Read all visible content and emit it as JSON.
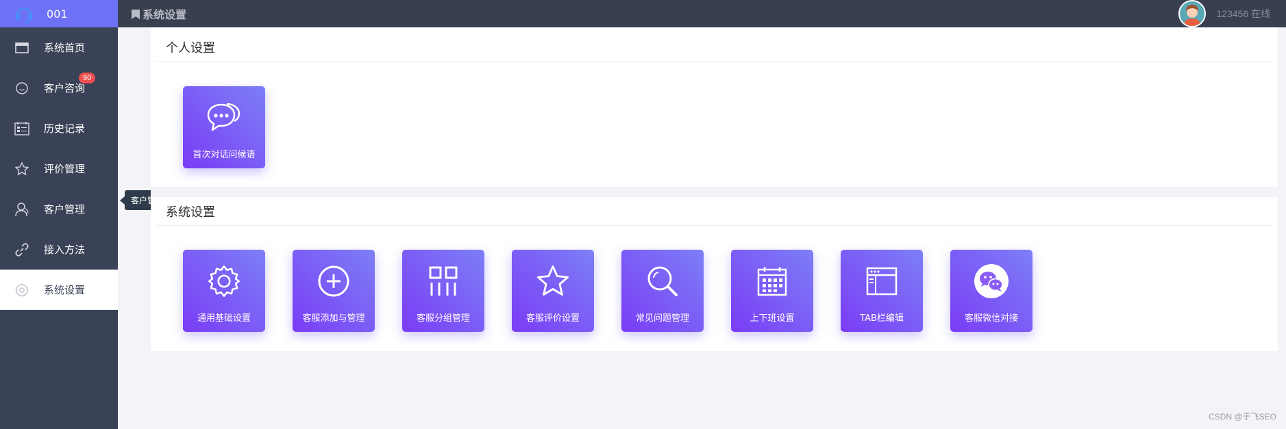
{
  "brand": {
    "id": "001",
    "logo_icon": "headset-icon"
  },
  "header": {
    "title": "系统设置",
    "username": "123456",
    "status": "在线"
  },
  "sidebar": {
    "items": [
      {
        "label": "系统首页",
        "icon": "window-icon"
      },
      {
        "label": "客户咨询",
        "icon": "chat-bubble-icon",
        "badge": "90"
      },
      {
        "label": "历史记录",
        "icon": "calendar-list-icon"
      },
      {
        "label": "评价管理",
        "icon": "star-icon"
      },
      {
        "label": "客户管理",
        "icon": "user-icon"
      },
      {
        "label": "接入方法",
        "icon": "link-icon"
      },
      {
        "label": "系统设置",
        "icon": "gear-icon",
        "active": true
      }
    ]
  },
  "tooltip": {
    "text": "客户管理"
  },
  "personal": {
    "heading": "个人设置",
    "tiles": [
      {
        "label": "首次对话问候语",
        "icon": "chat-dots-icon"
      }
    ]
  },
  "system": {
    "heading": "系统设置",
    "tiles": [
      {
        "label": "通用基础设置",
        "icon": "gear-icon"
      },
      {
        "label": "客服添加与管理",
        "icon": "plus-circle-icon"
      },
      {
        "label": "客服分组管理",
        "icon": "grid-group-icon"
      },
      {
        "label": "客服评价设置",
        "icon": "star-icon"
      },
      {
        "label": "常见问题管理",
        "icon": "search-icon"
      },
      {
        "label": "上下班设置",
        "icon": "calendar-icon"
      },
      {
        "label": "TAB栏编辑",
        "icon": "browser-window-icon"
      },
      {
        "label": "客服微信对接",
        "icon": "wechat-icon"
      }
    ]
  },
  "footer": {
    "watermark": "CSDN @于飞SEO"
  },
  "colors": {
    "sidebar": "#3a4257",
    "brand": "#6d71f6",
    "topbar": "#3a3f4f",
    "tile_start": "#7a3cf5",
    "tile_end": "#7d7ff7",
    "badge": "#f0504f"
  }
}
